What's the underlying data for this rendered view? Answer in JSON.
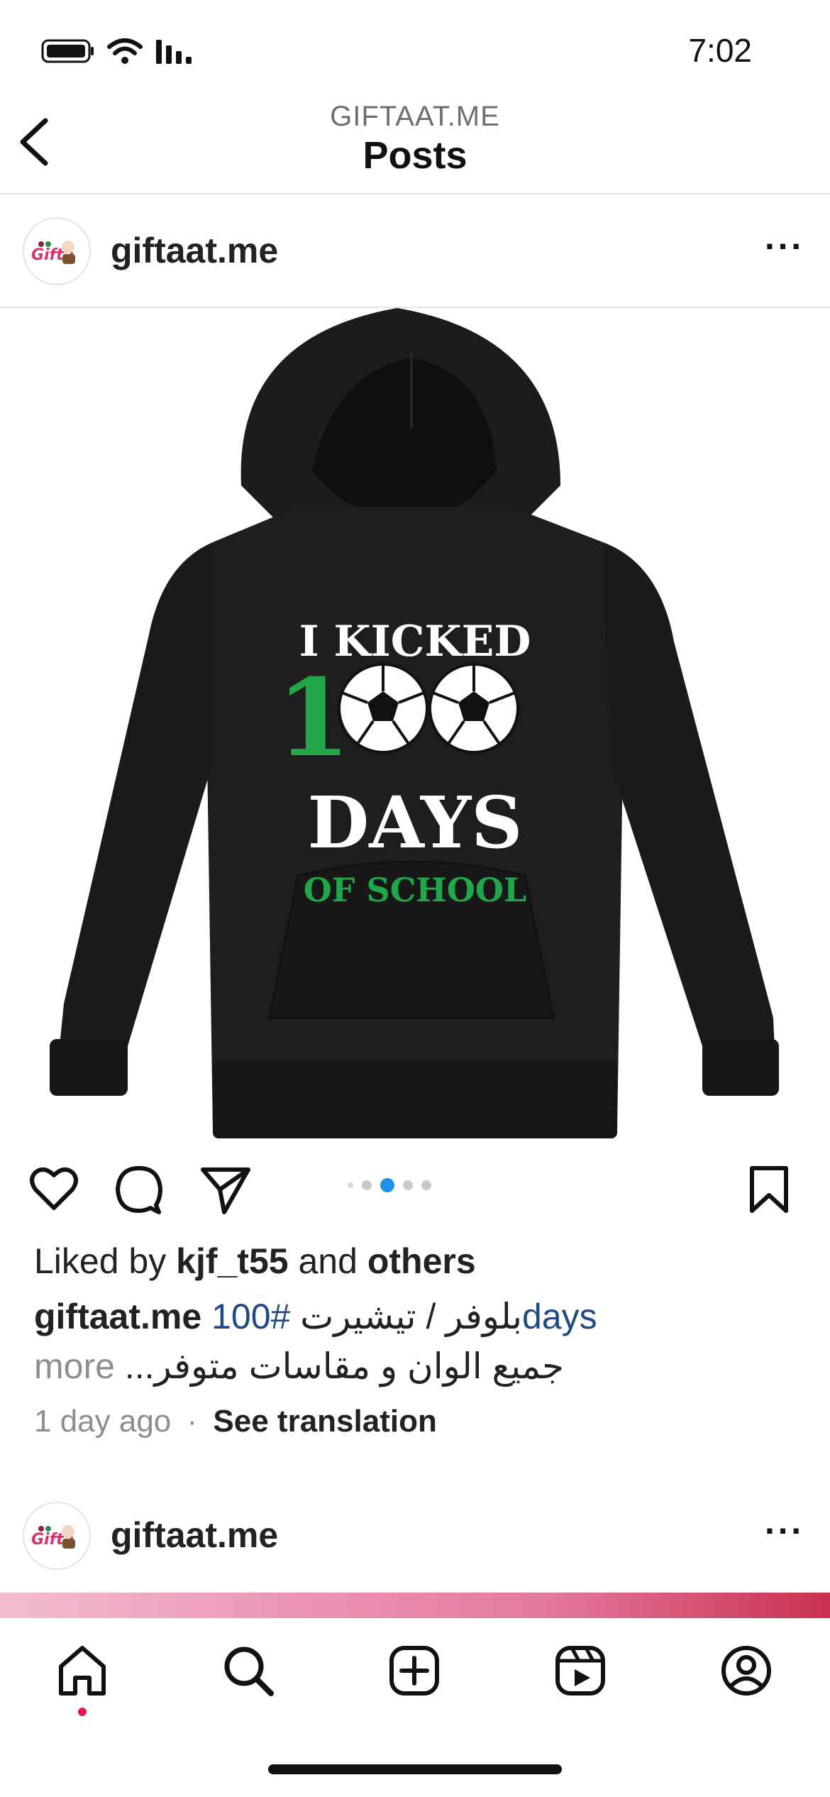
{
  "status_bar": {
    "time": "7:02"
  },
  "header": {
    "subtitle": "GIFTAAT.ME",
    "title": "Posts"
  },
  "post1": {
    "username": "giftaat.me",
    "image": {
      "line1": "I KICKED",
      "line2_digit": "1",
      "line3": "DAYS",
      "line4": "OF SCHOOL",
      "accent_green": "#22a64a"
    },
    "carousel": {
      "count": 5,
      "active": 2
    },
    "likes": {
      "prefix": "Liked by",
      "user": "kjf_t55",
      "and": "and",
      "others": "others"
    },
    "caption": {
      "username": "giftaat.me",
      "tag_prefix": "100#",
      "text_ar": "بلوفر / تيشيرت ",
      "tag_suffix": "days",
      "line2_more": "more",
      "line2_ar": "جميع الوان و مقاسات متوفر..."
    },
    "time_ago": "1 day ago",
    "separator": "·",
    "see_translation": "See translation"
  },
  "post2": {
    "username": "giftaat.me"
  },
  "colors": {
    "link_blue": "#1f4a86",
    "active_dot": "#1e90e8",
    "notif_red": "#e8144e"
  },
  "icons": [
    "back-icon",
    "more-icon",
    "heart-icon",
    "comment-icon",
    "share-icon",
    "bookmark-icon",
    "home-icon",
    "search-icon",
    "create-icon",
    "reels-icon",
    "profile-icon"
  ]
}
